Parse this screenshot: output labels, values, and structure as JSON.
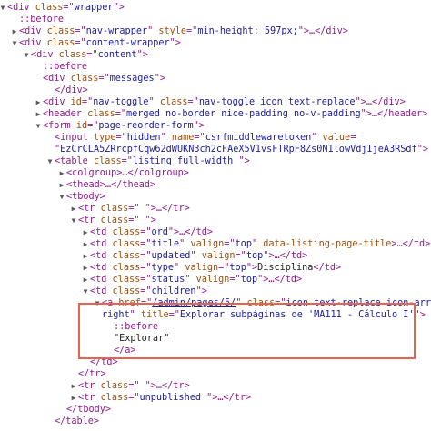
{
  "highlight_color": "#e8634d",
  "lines": [
    {
      "indent": 0,
      "tw": "down",
      "parts": [
        [
          "tag",
          "<div "
        ],
        [
          "attr",
          "class"
        ],
        [
          "tag",
          "=\""
        ],
        [
          "val",
          "wrapper"
        ],
        [
          "tag",
          "\">"
        ]
      ]
    },
    {
      "indent": 1,
      "tw": "",
      "parts": [
        [
          "pseudo",
          "::before"
        ]
      ]
    },
    {
      "indent": 1,
      "tw": "right",
      "parts": [
        [
          "tag",
          "<div "
        ],
        [
          "attr",
          "class"
        ],
        [
          "tag",
          "=\""
        ],
        [
          "val",
          "nav-wrapper"
        ],
        [
          "tag",
          "\" "
        ],
        [
          "attr",
          "style"
        ],
        [
          "tag",
          "=\""
        ],
        [
          "val",
          "min-height: 597px;"
        ],
        [
          "tag",
          "\">…</div>"
        ]
      ]
    },
    {
      "indent": 1,
      "tw": "down",
      "parts": [
        [
          "tag",
          "<div "
        ],
        [
          "attr",
          "class"
        ],
        [
          "tag",
          "=\""
        ],
        [
          "val",
          "content-wrapper"
        ],
        [
          "tag",
          "\">"
        ]
      ]
    },
    {
      "indent": 2,
      "tw": "down",
      "parts": [
        [
          "tag",
          "<div "
        ],
        [
          "attr",
          "class"
        ],
        [
          "tag",
          "=\""
        ],
        [
          "val",
          "content"
        ],
        [
          "tag",
          "\">"
        ]
      ]
    },
    {
      "indent": 3,
      "tw": "",
      "parts": [
        [
          "pseudo",
          "::before"
        ]
      ]
    },
    {
      "indent": 3,
      "tw": "",
      "parts": [
        [
          "tag",
          "<div "
        ],
        [
          "attr",
          "class"
        ],
        [
          "tag",
          "=\""
        ],
        [
          "val",
          "messages"
        ],
        [
          "tag",
          "\">"
        ]
      ]
    },
    {
      "indent": 4,
      "tw": "",
      "parts": [
        [
          "tag",
          "</div>"
        ]
      ]
    },
    {
      "indent": 3,
      "tw": "right",
      "parts": [
        [
          "tag",
          "<div "
        ],
        [
          "attr",
          "id"
        ],
        [
          "tag",
          "=\""
        ],
        [
          "val",
          "nav-toggle"
        ],
        [
          "tag",
          "\" "
        ],
        [
          "attr",
          "class"
        ],
        [
          "tag",
          "=\""
        ],
        [
          "val",
          "nav-toggle icon text-replace"
        ],
        [
          "tag",
          "\">…</div>"
        ]
      ]
    },
    {
      "indent": 3,
      "tw": "right",
      "parts": [
        [
          "tag",
          "<header "
        ],
        [
          "attr",
          "class"
        ],
        [
          "tag",
          "=\""
        ],
        [
          "val",
          "merged no-border nice-padding no-v-padding"
        ],
        [
          "tag",
          "\">…</header>"
        ]
      ]
    },
    {
      "indent": 3,
      "tw": "down",
      "parts": [
        [
          "tag",
          "<form "
        ],
        [
          "attr",
          "id"
        ],
        [
          "tag",
          "=\""
        ],
        [
          "val",
          "page-reorder-form"
        ],
        [
          "tag",
          "\">"
        ]
      ]
    },
    {
      "indent": 4,
      "tw": "",
      "parts": [
        [
          "tag",
          "<input "
        ],
        [
          "attr",
          "type"
        ],
        [
          "tag",
          "=\""
        ],
        [
          "val",
          "hidden"
        ],
        [
          "tag",
          "\" "
        ],
        [
          "attr",
          "name"
        ],
        [
          "tag",
          "=\""
        ],
        [
          "val",
          "csrfmiddlewaretoken"
        ],
        [
          "tag",
          "\" "
        ],
        [
          "attr",
          "value"
        ],
        [
          "tag",
          "="
        ]
      ]
    },
    {
      "indent": 4,
      "tw": "",
      "parts": [
        [
          "tag",
          "\""
        ],
        [
          "val",
          "EzCrCLA5ZRrcpfCqw62dWUKN3ch2cFAeX5V1vsFTRpF8Zs0N1lowVdjIjeA3RSdf"
        ],
        [
          "tag",
          "\">"
        ]
      ]
    },
    {
      "indent": 4,
      "tw": "down",
      "parts": [
        [
          "tag",
          "<table "
        ],
        [
          "attr",
          "class"
        ],
        [
          "tag",
          "=\""
        ],
        [
          "val",
          "listing full-width "
        ],
        [
          "tag",
          "\">"
        ]
      ]
    },
    {
      "indent": 5,
      "tw": "right",
      "parts": [
        [
          "tag",
          "<colgroup>…</colgroup>"
        ]
      ]
    },
    {
      "indent": 5,
      "tw": "right",
      "parts": [
        [
          "tag",
          "<thead>…</thead>"
        ]
      ]
    },
    {
      "indent": 5,
      "tw": "down",
      "parts": [
        [
          "tag",
          "<tbody>"
        ]
      ]
    },
    {
      "indent": 6,
      "tw": "right",
      "parts": [
        [
          "tag",
          "<tr "
        ],
        [
          "attr",
          "class"
        ],
        [
          "tag",
          "=\""
        ],
        [
          "val",
          " "
        ],
        [
          "tag",
          "\">…</tr>"
        ]
      ]
    },
    {
      "indent": 6,
      "tw": "down",
      "parts": [
        [
          "tag",
          "<tr "
        ],
        [
          "attr",
          "class"
        ],
        [
          "tag",
          "=\""
        ],
        [
          "val",
          " "
        ],
        [
          "tag",
          "\">"
        ]
      ]
    },
    {
      "indent": 7,
      "tw": "right",
      "parts": [
        [
          "tag",
          "<td "
        ],
        [
          "attr",
          "class"
        ],
        [
          "tag",
          "=\""
        ],
        [
          "val",
          "ord"
        ],
        [
          "tag",
          "\">…</td>"
        ]
      ]
    },
    {
      "indent": 7,
      "tw": "right",
      "parts": [
        [
          "tag",
          "<td "
        ],
        [
          "attr",
          "class"
        ],
        [
          "tag",
          "=\""
        ],
        [
          "val",
          "title"
        ],
        [
          "tag",
          "\" "
        ],
        [
          "attr",
          "valign"
        ],
        [
          "tag",
          "=\""
        ],
        [
          "val",
          "top"
        ],
        [
          "tag",
          "\" "
        ],
        [
          "attr",
          "data-listing-page-title"
        ],
        [
          "tag",
          ">…</td>"
        ]
      ]
    },
    {
      "indent": 7,
      "tw": "right",
      "parts": [
        [
          "tag",
          "<td "
        ],
        [
          "attr",
          "class"
        ],
        [
          "tag",
          "=\""
        ],
        [
          "val",
          "updated"
        ],
        [
          "tag",
          "\" "
        ],
        [
          "attr",
          "valign"
        ],
        [
          "tag",
          "=\""
        ],
        [
          "val",
          "top"
        ],
        [
          "tag",
          "\">…</td>"
        ]
      ]
    },
    {
      "indent": 7,
      "tw": "right",
      "parts": [
        [
          "tag",
          "<td "
        ],
        [
          "attr",
          "class"
        ],
        [
          "tag",
          "=\""
        ],
        [
          "val",
          "type"
        ],
        [
          "tag",
          "\" "
        ],
        [
          "attr",
          "valign"
        ],
        [
          "tag",
          "=\""
        ],
        [
          "val",
          "top"
        ],
        [
          "tag",
          "\">"
        ],
        [
          "text",
          "Disciplina"
        ],
        [
          "tag",
          "</td>"
        ]
      ]
    },
    {
      "indent": 7,
      "tw": "right",
      "parts": [
        [
          "tag",
          "<td "
        ],
        [
          "attr",
          "class"
        ],
        [
          "tag",
          "=\""
        ],
        [
          "val",
          "status"
        ],
        [
          "tag",
          "\" "
        ],
        [
          "attr",
          "valign"
        ],
        [
          "tag",
          "=\""
        ],
        [
          "val",
          "top"
        ],
        [
          "tag",
          "\">…</td>"
        ]
      ]
    },
    {
      "indent": 7,
      "tw": "down",
      "parts": [
        [
          "tag",
          "<td "
        ],
        [
          "attr",
          "class"
        ],
        [
          "tag",
          "=\""
        ],
        [
          "val",
          "children"
        ],
        [
          "tag",
          "\">"
        ]
      ]
    },
    {
      "indent": 8,
      "tw": "down",
      "parts": [
        [
          "tag",
          "<a "
        ],
        [
          "attr",
          "href"
        ],
        [
          "tag",
          "=\""
        ],
        [
          "link",
          "/admin/pages/5/"
        ],
        [
          "tag",
          "\" "
        ],
        [
          "attr",
          "class"
        ],
        [
          "tag",
          "=\""
        ],
        [
          "val",
          "icon text-replace icon-arrow-"
        ]
      ]
    },
    {
      "indent": 8,
      "tw": "",
      "parts": [
        [
          "val",
          "right"
        ],
        [
          "tag",
          "\" "
        ],
        [
          "attr",
          "title"
        ],
        [
          "tag",
          "=\""
        ],
        [
          "val",
          "Explorar subpáginas de 'MA111 - Cálculo I'"
        ],
        [
          "tag",
          "\">"
        ]
      ]
    },
    {
      "indent": 9,
      "tw": "",
      "parts": [
        [
          "pseudo",
          "::before"
        ]
      ]
    },
    {
      "indent": 9,
      "tw": "",
      "parts": [
        [
          "text",
          "\"Explorar\""
        ]
      ]
    },
    {
      "indent": 9,
      "tw": "",
      "parts": [
        [
          "tag",
          "</a>"
        ]
      ]
    },
    {
      "indent": 7,
      "tw": "",
      "parts": [
        [
          "tag",
          "</td>"
        ]
      ]
    },
    {
      "indent": 6,
      "tw": "",
      "parts": [
        [
          "tag",
          "</tr>"
        ]
      ]
    },
    {
      "indent": 6,
      "tw": "right",
      "parts": [
        [
          "tag",
          "<tr "
        ],
        [
          "attr",
          "class"
        ],
        [
          "tag",
          "=\""
        ],
        [
          "val",
          " "
        ],
        [
          "tag",
          "\">…</tr>"
        ]
      ]
    },
    {
      "indent": 6,
      "tw": "right",
      "parts": [
        [
          "tag",
          "<tr "
        ],
        [
          "attr",
          "class"
        ],
        [
          "tag",
          "=\""
        ],
        [
          "val",
          "unpublished "
        ],
        [
          "tag",
          "\">…</tr>"
        ]
      ]
    },
    {
      "indent": 5,
      "tw": "",
      "parts": [
        [
          "tag",
          "</tbody>"
        ]
      ]
    },
    {
      "indent": 4,
      "tw": "",
      "parts": [
        [
          "tag",
          "</table>"
        ]
      ]
    }
  ]
}
